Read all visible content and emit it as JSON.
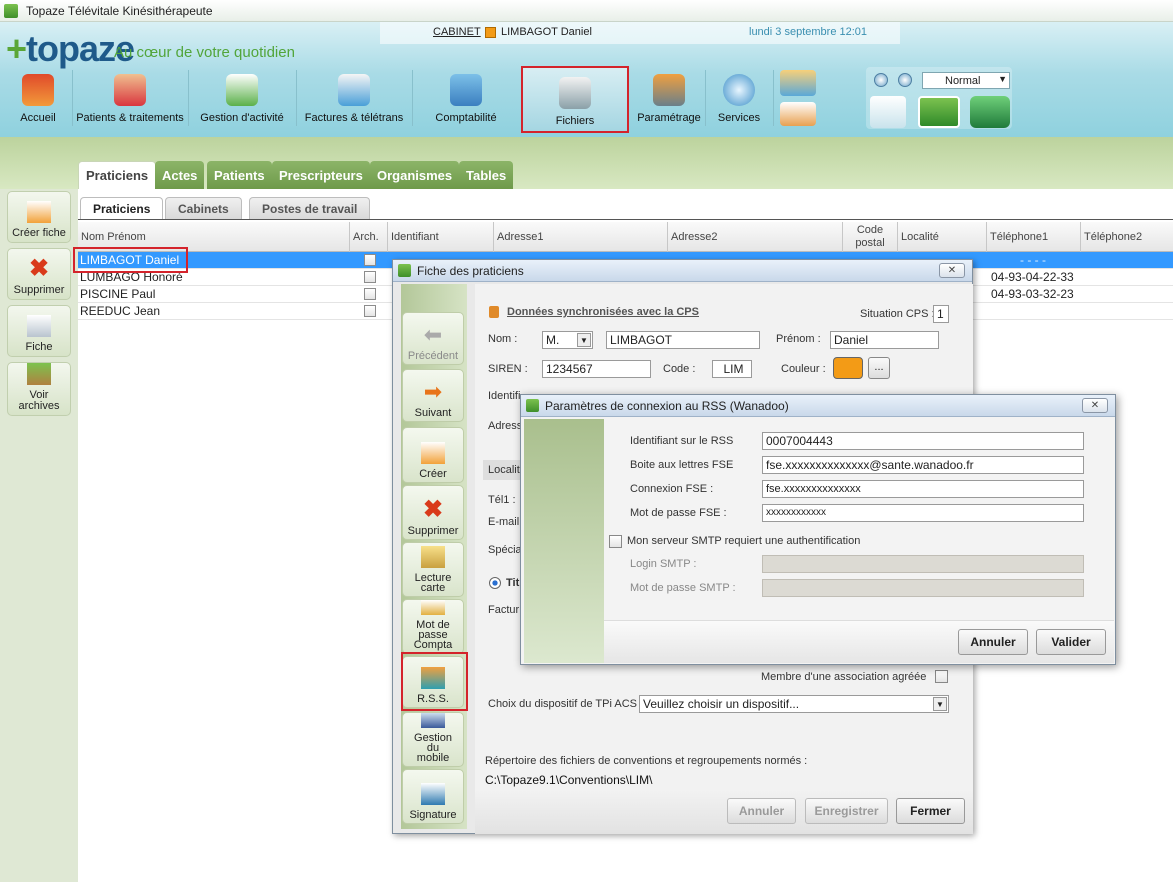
{
  "window": {
    "title": "Topaze Télévitale Kinésithérapeute"
  },
  "header": {
    "logo_text": "topaze",
    "tagline": "Au cœur de votre quotidien",
    "cabinet_label": "CABINET",
    "practitioner": "LIMBAGOT Daniel",
    "datetime": "lundi 3 septembre 12:01",
    "cabinet_color": "#f39b16",
    "view_mode": "Normal"
  },
  "toolbar": [
    {
      "label": "Accueil",
      "icon": "house-icon"
    },
    {
      "label": "Patients & traitements",
      "icon": "patients-icon"
    },
    {
      "label": "Gestion d'activité",
      "icon": "activity-icon"
    },
    {
      "label": "Factures & télétrans",
      "icon": "invoices-icon"
    },
    {
      "label": "Comptabilité",
      "icon": "calculator-icon"
    },
    {
      "label": "Fichiers",
      "icon": "database-icon"
    },
    {
      "label": "Paramétrage",
      "icon": "gears-icon"
    },
    {
      "label": "Services",
      "icon": "globe-icon"
    }
  ],
  "main_tabs": [
    "Praticiens",
    "Actes",
    "Patients",
    "Prescripteurs",
    "Organismes",
    "Tables"
  ],
  "sub_tabs": [
    "Praticiens",
    "Cabinets",
    "Postes de travail"
  ],
  "sidebar": [
    "Créer fiche",
    "Supprimer",
    "Fiche",
    "Voir archives"
  ],
  "grid": {
    "columns": [
      "Nom Prénom",
      "Arch.",
      "Identifiant",
      "Adresse1",
      "Adresse2",
      "Code postal",
      "Localité",
      "Téléphone1",
      "Téléphone2"
    ],
    "rows": [
      {
        "name": "LIMBAGOT Daniel",
        "tel_partial": "- - - -"
      },
      {
        "name": "LUMBAGO Honoré",
        "tel1": "04-93-04-22-33"
      },
      {
        "name": "PISCINE Paul",
        "tel1": "04-93-03-32-23"
      },
      {
        "name": "REEDUC Jean",
        "tel1": ""
      }
    ]
  },
  "fiche": {
    "title": "Fiche des praticiens",
    "sync_label": "Données synchronisées avec la CPS",
    "situation_label": "Situation CPS :",
    "situation_value": "1",
    "nom_label": "Nom :",
    "civilite": "M.",
    "nom_value": "LIMBAGOT",
    "prenom_label": "Prénom :",
    "prenom_value": "Daniel",
    "siren_label": "SIREN :",
    "siren_value": "1234567",
    "code_label": "Code :",
    "code_value": "LIM",
    "couleur_label": "Couleur :",
    "couleur_value": "#f39b16",
    "more_btn": "...",
    "side_buttons": [
      "Précédent",
      "Suivant",
      "Créer",
      "Supprimer",
      "Lecture carte",
      "Mot de passe Compta",
      "R.S.S.",
      "Gestion du mobile",
      "Signature"
    ],
    "partial_labels": {
      "identifiant": "Identifi",
      "adresse": "Adress",
      "localite": "Localit",
      "tel1": "Tél1 :",
      "email": "E-mail",
      "specialite": "Spécia",
      "titulaire": "Tit",
      "factur": "Factur"
    },
    "membre_label": "Membre d'une association agréée",
    "tpi_label": "Choix du dispositif de TPi ACS :",
    "tpi_value": "Veuillez choisir un dispositif...",
    "repertoire_label": "Répertoire des fichiers de conventions et regroupements normés :",
    "repertoire_value": "C:\\Topaze9.1\\Conventions\\LIM\\",
    "btn_annuler": "Annuler",
    "btn_enregistrer": "Enregistrer",
    "btn_fermer": "Fermer"
  },
  "rss": {
    "title": "Paramètres de connexion au RSS (Wanadoo)",
    "id_label": "Identifiant sur le RSS",
    "id_value": "0007004443",
    "bal_label": "Boite aux lettres FSE",
    "bal_value": "fse.xxxxxxxxxxxxxx@sante.wanadoo.fr",
    "cnx_label": "Connexion FSE :",
    "cnx_value": "fse.xxxxxxxxxxxxxx",
    "pwd_label": "Mot de passe FSE :",
    "pwd_value": "xxxxxxxxxxxx",
    "smtp_auth_label": "Mon serveur SMTP requiert une authentification",
    "login_smtp_label": "Login SMTP :",
    "pwd_smtp_label": "Mot de passe SMTP :",
    "btn_annuler": "Annuler",
    "btn_valider": "Valider"
  }
}
